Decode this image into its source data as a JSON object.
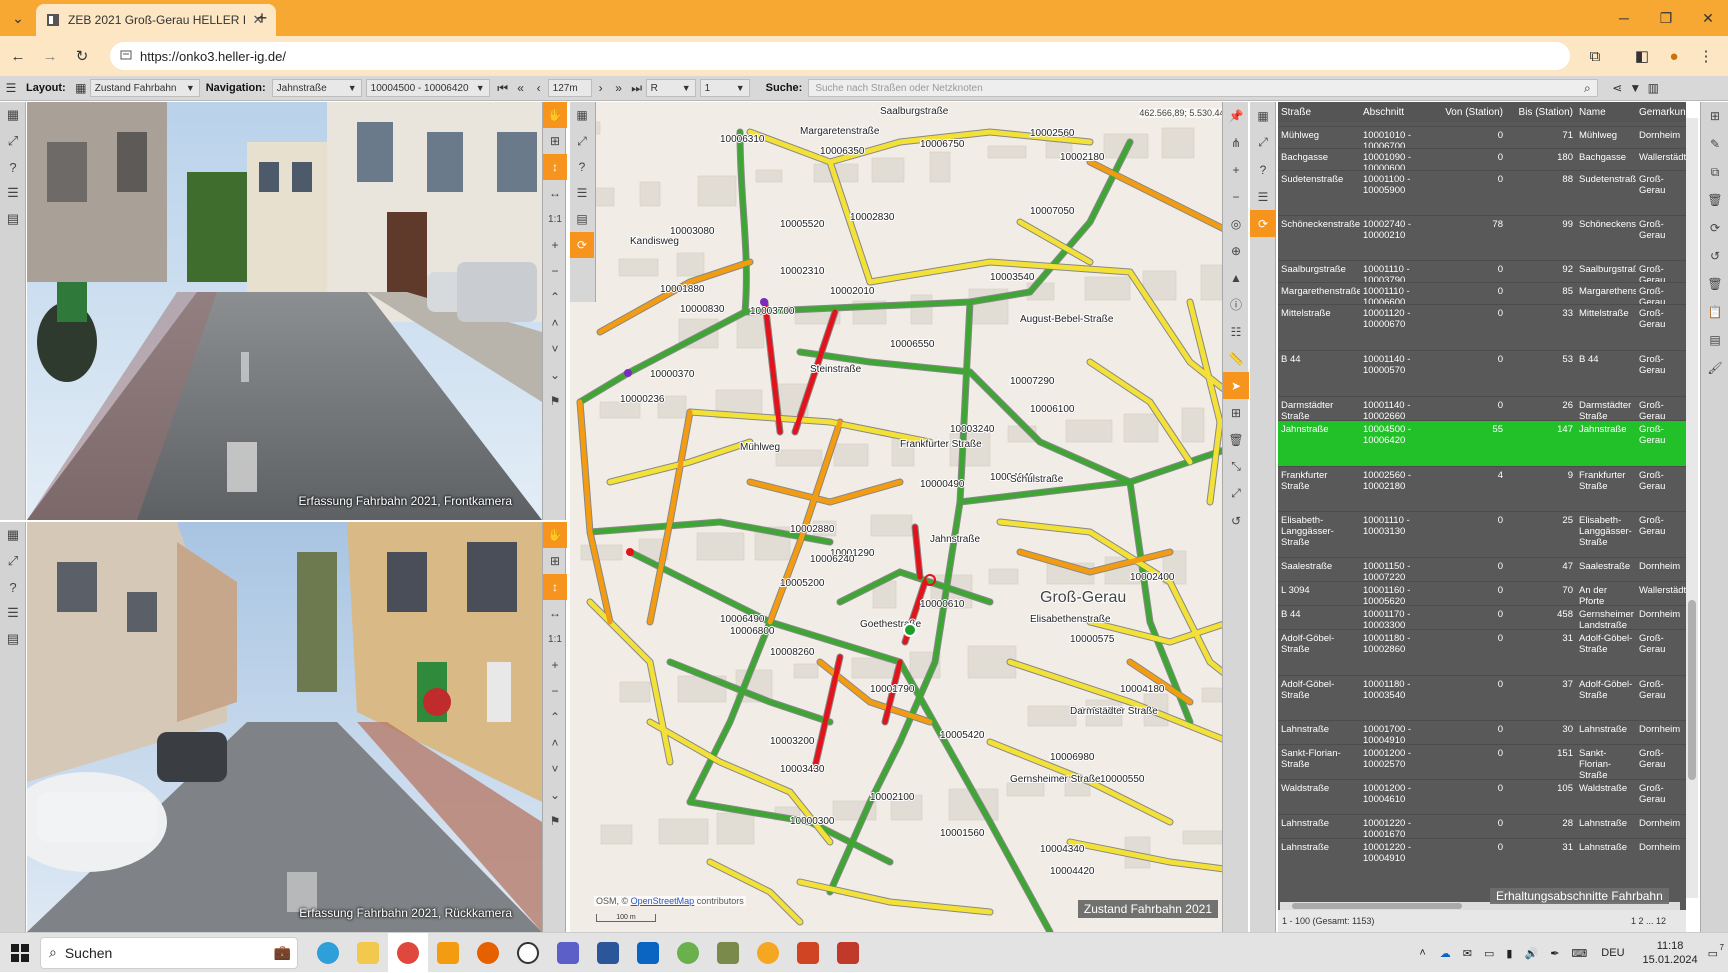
{
  "browser": {
    "tab_title": "ZEB 2021 Groß-Gerau HELLER I",
    "url": "https://onko3.heller-ig.de/"
  },
  "toolbar": {
    "layout_label": "Layout:",
    "layout_value": "Zustand Fahrbahn",
    "navigation_label": "Navigation:",
    "navigation_value": "Jahnstraße",
    "section_value": "10004500 - 10006420",
    "distance_value": "127m",
    "direction_value": "R",
    "lane_value": "1",
    "search_label": "Suche:",
    "search_placeholder": "Suche nach Straßen oder Netzknoten"
  },
  "cameras": {
    "front_caption": "Erfassung Fahrbahn 2021, Frontkamera",
    "rear_caption": "Erfassung Fahrbahn 2021, Rückkamera",
    "ratio_label": "1:1"
  },
  "map": {
    "coordinates": "462.566,89; 5.530.448,74",
    "legend": "Zustand Fahrbahn 2021",
    "osm_prefix": "OSM, ©",
    "osm_link": "OpenStreetMap",
    "osm_suffix": "contributors",
    "scale": "100 m",
    "labels": [
      "Saalburgstraße",
      "Margaretenstraße",
      "10006310",
      "10006350",
      "10006750",
      "10002560",
      "10002180",
      "10005520",
      "10007050",
      "10002830",
      "10003080",
      "10002310",
      "10003540",
      "10002010",
      "Kandisweg",
      "10000830",
      "10003700",
      "10006550",
      "10000370",
      "10007290",
      "10006490",
      "10000236",
      "10003240",
      "10006100",
      "Mühlweg",
      "Frankfurter Straße",
      "10004640",
      "10000490",
      "10002880",
      "10001290",
      "10006240",
      "10005200",
      "10006800",
      "10008260",
      "10000610",
      "10001790",
      "Groß-Gerau",
      "10000575",
      "10002400",
      "10004180",
      "10006710",
      "10000550",
      "10005420",
      "10006980",
      "10003200",
      "10003430",
      "10002100",
      "10000300",
      "10001560",
      "10004340",
      "10004420",
      "10001880",
      "Jahnstraße",
      "Steinstraße",
      "Goethestraße",
      "Darmstädter Straße",
      "Gernsheimer Straße",
      "Elisabethenstraße",
      "Schulstraße",
      "August-Bebel-Straße"
    ]
  },
  "table": {
    "headers": [
      "Straße",
      "Abschnitt",
      "Von (Station)",
      "Bis (Station)",
      "Name",
      "Gemarkung"
    ],
    "rows": [
      {
        "strasse": "Mühlweg",
        "abschnitt": "10001010 - 10006700",
        "von": "0",
        "bis": "71",
        "name": "Mühlweg",
        "gem": "Dornheim",
        "h": 22
      },
      {
        "strasse": "Bachgasse",
        "abschnitt": "10001090 - 10000600",
        "von": "0",
        "bis": "180",
        "name": "Bachgasse",
        "gem": "Wallerstädten",
        "h": 22
      },
      {
        "strasse": "Sudetenstraße",
        "abschnitt": "10001100 - 10005900",
        "von": "0",
        "bis": "88",
        "name": "Sudetenstraße",
        "gem": "Groß-Gerau",
        "h": 45
      },
      {
        "strasse": "Schöneckenstraße",
        "abschnitt": "10002740 - 10000210",
        "von": "78",
        "bis": "99",
        "name": "Schöneckenstraße",
        "gem": "Groß-Gerau",
        "h": 45
      },
      {
        "strasse": "Saalburgstraße",
        "abschnitt": "10001110 - 10003790",
        "von": "0",
        "bis": "92",
        "name": "Saalburgstraße",
        "gem": "Groß-Gerau",
        "h": 22
      },
      {
        "strasse": "Margarethenstraße",
        "abschnitt": "10001110 - 10006600",
        "von": "0",
        "bis": "85",
        "name": "Margarethenstraße",
        "gem": "Groß-Gerau",
        "h": 22
      },
      {
        "strasse": "Mittelstraße",
        "abschnitt": "10001120 - 10000670",
        "von": "0",
        "bis": "33",
        "name": "Mittelstraße",
        "gem": "Groß-Gerau",
        "h": 46
      },
      {
        "strasse": "B 44",
        "abschnitt": "10001140 - 10000570",
        "von": "0",
        "bis": "53",
        "name": "B 44",
        "gem": "Groß-Gerau",
        "h": 46
      },
      {
        "strasse": "Darmstädter Straße",
        "abschnitt": "10001140 - 10002660",
        "von": "0",
        "bis": "26",
        "name": "Darmstädter Straße",
        "gem": "Groß-Gerau",
        "h": 24
      },
      {
        "strasse": "Jahnstraße",
        "abschnitt": "10004500 - 10006420",
        "von": "55",
        "bis": "147",
        "name": "Jahnstraße",
        "gem": "Groß-Gerau",
        "h": 46,
        "selected": true
      },
      {
        "strasse": "Frankfurter Straße",
        "abschnitt": "10002560 - 10002180",
        "von": "4",
        "bis": "9",
        "name": "Frankfurter Straße",
        "gem": "Groß-Gerau",
        "h": 45
      },
      {
        "strasse": "Elisabeth-Langgässer-Straße",
        "abschnitt": "10001110 - 10003130",
        "von": "0",
        "bis": "25",
        "name": "Elisabeth-Langgässer-Straße",
        "gem": "Groß-Gerau",
        "h": 46
      },
      {
        "strasse": "Saalestraße",
        "abschnitt": "10001150 - 10007220",
        "von": "0",
        "bis": "47",
        "name": "Saalestraße",
        "gem": "Dornheim",
        "h": 24
      },
      {
        "strasse": "L 3094",
        "abschnitt": "10001160 - 10005620",
        "von": "0",
        "bis": "70",
        "name": "An der Pforte",
        "gem": "Wallerstädten",
        "h": 24
      },
      {
        "strasse": "B 44",
        "abschnitt": "10001170 - 10003300",
        "von": "0",
        "bis": "458",
        "name": "Gernsheimer Landstraße",
        "gem": "Dornheim",
        "h": 24
      },
      {
        "strasse": "Adolf-Göbel-Straße",
        "abschnitt": "10001180 - 10002860",
        "von": "0",
        "bis": "31",
        "name": "Adolf-Göbel-Straße",
        "gem": "Groß-Gerau",
        "h": 46
      },
      {
        "strasse": "Adolf-Göbel-Straße",
        "abschnitt": "10001180 - 10003540",
        "von": "0",
        "bis": "37",
        "name": "Adolf-Göbel-Straße",
        "gem": "Groß-Gerau",
        "h": 45
      },
      {
        "strasse": "Lahnstraße",
        "abschnitt": "10001700 - 10004910",
        "von": "0",
        "bis": "30",
        "name": "Lahnstraße",
        "gem": "Dornheim",
        "h": 24
      },
      {
        "strasse": "Sankt-Florian-Straße",
        "abschnitt": "10001200 - 10002570",
        "von": "0",
        "bis": "151",
        "name": "Sankt-Florian-Straße",
        "gem": "Groß-Gerau",
        "h": 35
      },
      {
        "strasse": "Waldstraße",
        "abschnitt": "10001200 - 10004610",
        "von": "0",
        "bis": "105",
        "name": "Waldstraße",
        "gem": "Groß-Gerau",
        "h": 35
      },
      {
        "strasse": "Lahnstraße",
        "abschnitt": "10001220 - 10001670",
        "von": "0",
        "bis": "28",
        "name": "Lahnstraße",
        "gem": "Dornheim",
        "h": 24
      },
      {
        "strasse": "Lahnstraße",
        "abschnitt": "10001220 - 10004910",
        "von": "0",
        "bis": "31",
        "name": "Lahnstraße",
        "gem": "Dornheim",
        "h": 24
      }
    ],
    "overlay_label": "Erhaltungsabschnitte Fahrbahn",
    "footer_count": "1 - 100 (Gesamt: 1153)",
    "pager": "1 2 ... 12"
  },
  "taskbar": {
    "search": "Suchen",
    "lang": "DEU",
    "time": "11:18",
    "date": "15.01.2024",
    "notifications": "7"
  },
  "colors": {
    "orange": "#f7941d",
    "tabbar": "#f7a833",
    "road_green": "#3fa535",
    "road_yellow": "#f3e138",
    "road_orange": "#f39c12",
    "road_red": "#e3131b",
    "selected_row": "#22c12a"
  }
}
